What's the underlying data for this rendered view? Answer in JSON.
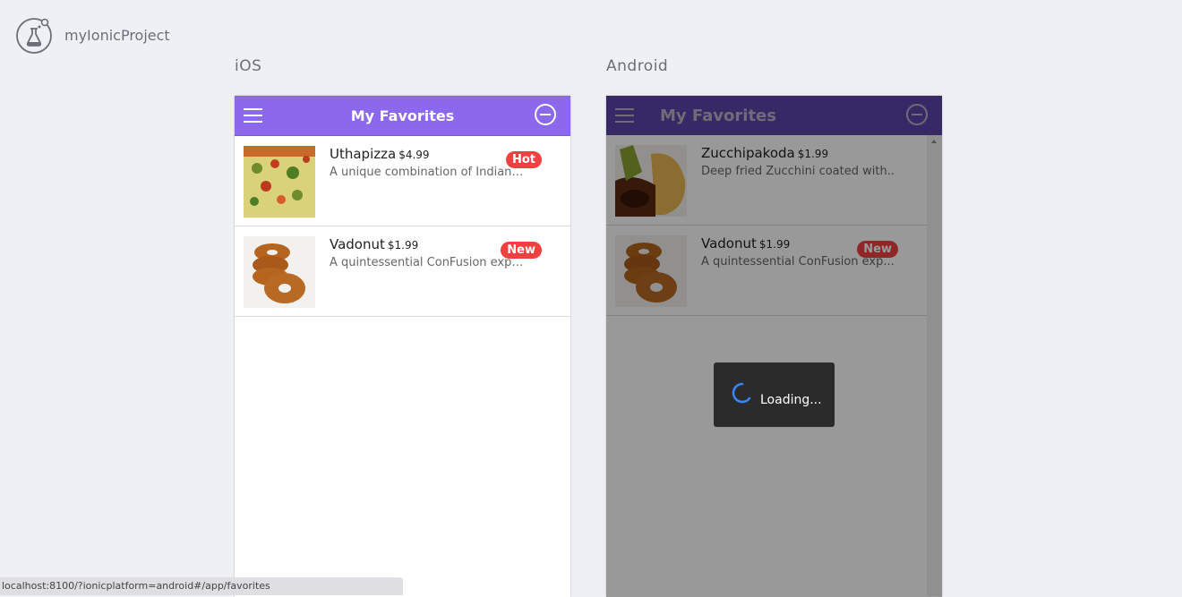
{
  "app": {
    "title": "myIonicProject",
    "logo_icon": "ionic-flask-icon"
  },
  "platforms": {
    "ios_label": "iOS",
    "android_label": "Android"
  },
  "ios": {
    "toolbar": {
      "title": "My Favorites",
      "menu_icon": "hamburger-icon",
      "action_icon": "remove-circle-icon"
    },
    "items": [
      {
        "name": "Uthapizza",
        "price": "$4.99",
        "description": "A unique combination of Indian U...",
        "badge": "Hot"
      },
      {
        "name": "Vadonut",
        "price": "$1.99",
        "description": "A quintessential ConFusion expen...",
        "badge": "New"
      }
    ]
  },
  "android": {
    "toolbar": {
      "title": "My Favorites",
      "menu_icon": "hamburger-icon",
      "action_icon": "remove-circle-icon"
    },
    "items": [
      {
        "name": "Zucchipakoda",
        "price": "$1.99",
        "description": "Deep fried Zucchini coated with..",
        "badge": ""
      },
      {
        "name": "Vadonut",
        "price": "$1.99",
        "description": "A quintessential ConFusion exp...",
        "badge": "New"
      }
    ],
    "loading": {
      "text": "Loading..."
    }
  },
  "status_bar": {
    "url": "localhost:8100/?ionicplatform=android#/app/favorites"
  },
  "colors": {
    "ios_toolbar": "#8b68ec",
    "android_toolbar": "#5c45a8",
    "badge": "#f04141",
    "spinner": "#3b86f7"
  }
}
